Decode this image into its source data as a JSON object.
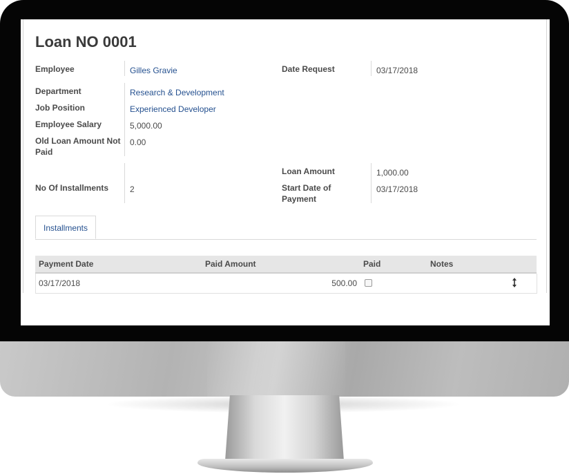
{
  "form": {
    "title": "Loan NO 0001",
    "employee_label": "Employee",
    "employee_value": "Gilles Gravie",
    "date_request_label": "Date Request",
    "date_request_value": "03/17/2018",
    "department_label": "Department",
    "department_value": "Research & Development",
    "job_position_label": "Job Position",
    "job_position_value": "Experienced Developer",
    "salary_label": "Employee Salary",
    "salary_value": "5,000.00",
    "old_loan_label": "Old Loan Amount Not Paid",
    "old_loan_value": "0.00",
    "installments_label": "No Of Installments",
    "installments_value": "2",
    "loan_amount_label": "Loan Amount",
    "loan_amount_value": "1,000.00",
    "start_date_label": "Start Date of Payment",
    "start_date_value": "03/17/2018"
  },
  "tabs": [
    {
      "label": "Installments"
    }
  ],
  "table": {
    "columns": [
      "Payment Date",
      "Paid Amount",
      "Paid",
      "Notes"
    ],
    "rows": [
      {
        "payment_date": "03/17/2018",
        "paid_amount": "500.00",
        "paid": false,
        "notes": ""
      }
    ]
  },
  "icons": {
    "row_handle": "drag-handle-icon",
    "paid_checkbox": "checkbox-icon"
  }
}
